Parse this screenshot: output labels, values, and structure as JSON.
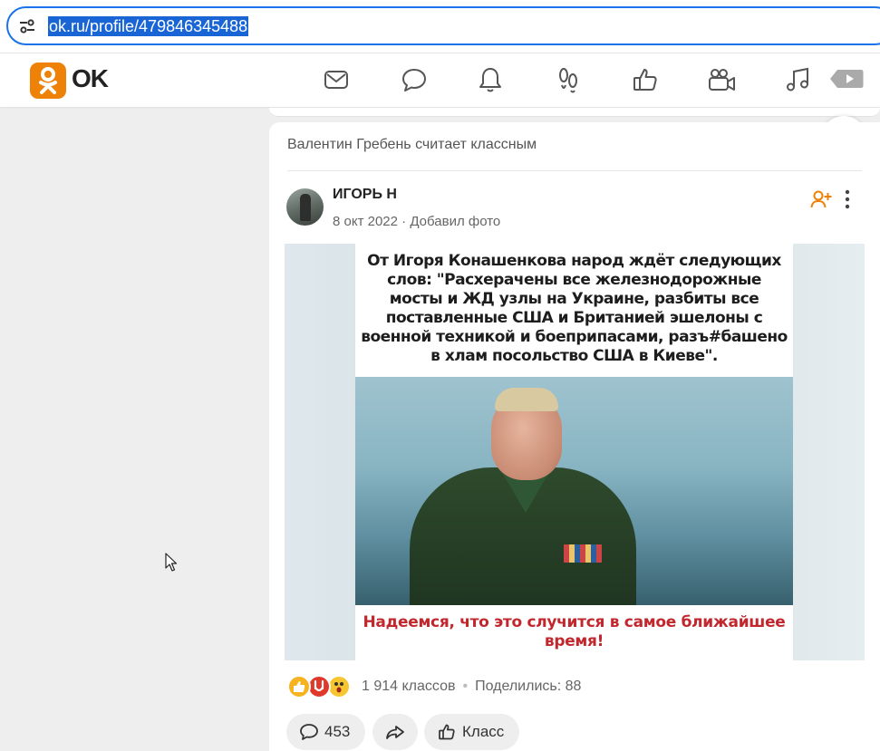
{
  "browser": {
    "url": "ok.ru/profile/479846345488",
    "tune_icon": "tune-icon"
  },
  "header": {
    "logo_text": "OK",
    "nav_icons": [
      "mail-icon",
      "chat-bubble-icon",
      "bell-icon",
      "guests-footprints-icon",
      "thumbs-up-icon",
      "video-camera-icon",
      "music-note-icon",
      "play-video-icon"
    ]
  },
  "post": {
    "liked_by": "Валентин Гребень считает классным",
    "author": "ИГОРЬ Н",
    "date": "8 окт 2022",
    "meta_sep": "·",
    "action": "Добавил фото",
    "image": {
      "top_text": "От Игоря Конашенкова народ ждёт следующих слов: \"Расхерачены все железнодорожные мосты и ЖД узлы на Украине, разбиты все поставленные США и Британией эшелоны с военной техникой и боеприпасами, разъ#башено в хлам посольство США в Киеве\".",
      "bottom_text": "Надеемся, что это случится в самое ближайшее время!"
    },
    "reactions": {
      "icons": [
        "like-reaction-icon",
        "rock-reaction-icon",
        "wow-reaction-icon"
      ],
      "klass_count": "1 914 классов",
      "separator": "•",
      "shared": "Поделились: 88"
    },
    "buttons": {
      "comments_count": "453",
      "klass_label": "Класс"
    }
  },
  "colors": {
    "accent": "#ee8208",
    "url_highlight": "#1a65d6",
    "poster_red": "#c1272d"
  }
}
